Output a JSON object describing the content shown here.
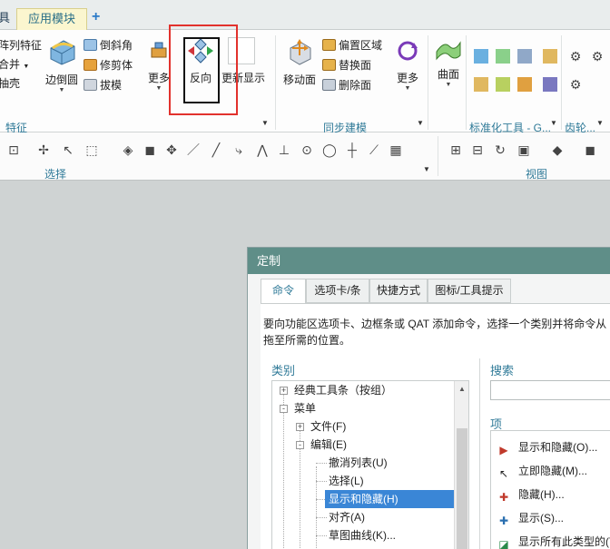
{
  "tabs": {
    "prev": "具",
    "active": "应用模块",
    "add": "+"
  },
  "ribbon": {
    "feature_group": {
      "items": [
        "阵列特征",
        "合并",
        "抽壳"
      ],
      "edge_blend": "边倒圆",
      "chamfer": "倒斜角",
      "trim_body": "修剪体",
      "draft": "拔模",
      "more": "更多",
      "reverse": "反向",
      "refresh": "更新显示",
      "label": "特征"
    },
    "sync_group": {
      "move_face": "移动面",
      "offset_region": "偏置区域",
      "replace_face": "替换面",
      "delete_face": "删除面",
      "more": "更多",
      "label": "同步建模"
    },
    "surface": {
      "label": "曲面"
    },
    "std_group": {
      "label": "标准化工具 - G..."
    },
    "gear_group": {
      "label": "齿轮..."
    }
  },
  "toolbar": {
    "select_label": "选择",
    "view_label": "视图"
  },
  "dialog": {
    "title": "定制",
    "tabs": [
      "命令",
      "选项卡/条",
      "快捷方式",
      "图标/工具提示"
    ],
    "description": "要向功能区选项卡、边框条或 QAT 添加命令，选择一个类别并将命令从",
    "description2": "拖至所需的位置。",
    "category_label": "类别",
    "search_label": "搜索",
    "items_label": "项",
    "tree": [
      {
        "label": "经典工具条（按组）",
        "level": 0,
        "exp": "+"
      },
      {
        "label": "菜单",
        "level": 0,
        "exp": "-"
      },
      {
        "label": "文件(F)",
        "level": 1,
        "exp": "+"
      },
      {
        "label": "编辑(E)",
        "level": 1,
        "exp": "-"
      },
      {
        "label": "撤消列表(U)",
        "level": 2,
        "exp": ""
      },
      {
        "label": "选择(L)",
        "level": 2,
        "exp": ""
      },
      {
        "label": "显示和隐藏(H)",
        "level": 2,
        "exp": "",
        "selected": true
      },
      {
        "label": "对齐(A)",
        "level": 2,
        "exp": ""
      },
      {
        "label": "草图曲线(K)...",
        "level": 2,
        "exp": ""
      }
    ],
    "items": [
      "显示和隐藏(O)...",
      "立即隐藏(M)...",
      "隐藏(H)...",
      "显示(S)...",
      "显示所有此类型的(T)"
    ]
  }
}
